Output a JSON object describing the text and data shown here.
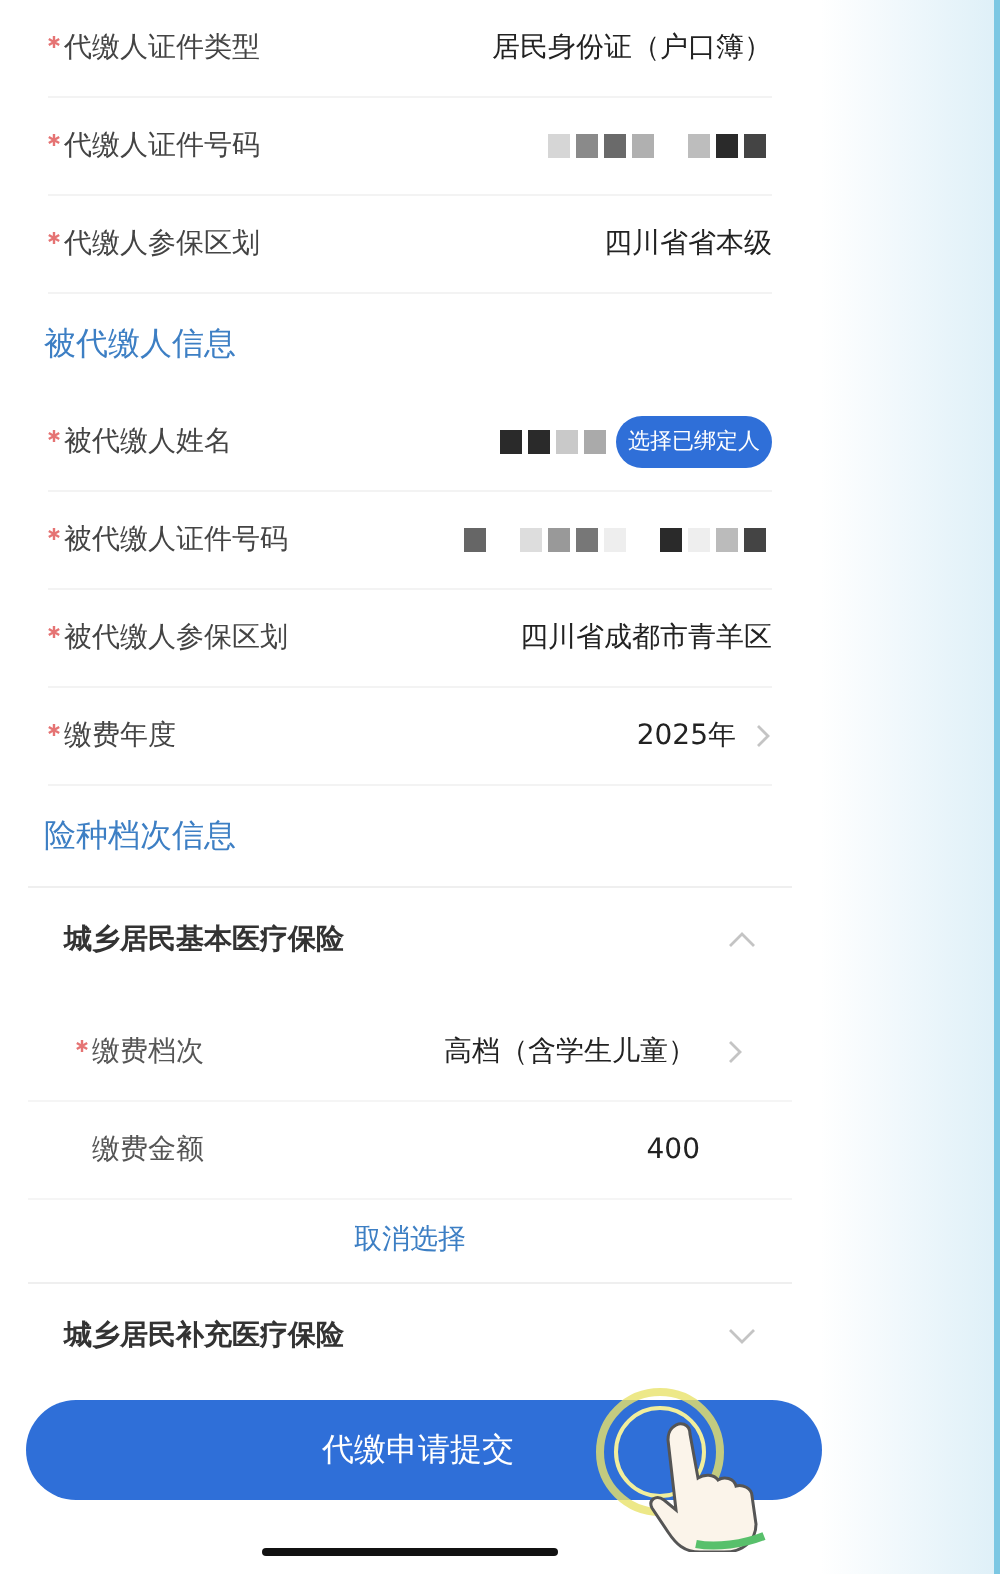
{
  "items": [
    {
      "kind": "field",
      "label": "代缴人证件类型",
      "required": true,
      "value": "居民身份证（户口簿）",
      "redacted": false,
      "chevron": false
    },
    {
      "kind": "field",
      "label": "代缴人证件号码",
      "required": true,
      "redacted": true,
      "chevron": false
    },
    {
      "kind": "field",
      "label": "代缴人参保区划",
      "required": true,
      "value": "四川省省本级",
      "redacted": false,
      "chevron": false
    },
    {
      "kind": "heading",
      "label": "被代缴人信息"
    },
    {
      "kind": "field",
      "label": "被代缴人姓名",
      "required": true,
      "redacted": true,
      "action": "选择已绑定人",
      "chevron": false
    },
    {
      "kind": "field",
      "label": "被代缴人证件号码",
      "required": true,
      "redacted": true,
      "chevron": false
    },
    {
      "kind": "field",
      "label": "被代缴人参保区划",
      "required": true,
      "value": "四川省成都市青羊区",
      "redacted": false,
      "chevron": false
    },
    {
      "kind": "field",
      "label": "缴费年度",
      "required": true,
      "value": "2025年",
      "redacted": false,
      "chevron": true
    },
    {
      "kind": "heading",
      "label": "险种档次信息"
    }
  ],
  "insurances": [
    {
      "title": "城乡居民基本医疗保险",
      "expanded": true,
      "fields": [
        {
          "label": "缴费档次",
          "required": true,
          "value": "高档（含学生儿童）",
          "chevron": true
        },
        {
          "label": "缴费金额",
          "required": false,
          "value": "400",
          "chevron": false
        }
      ],
      "cancel": "取消选择"
    },
    {
      "title": "城乡居民补充医疗保险",
      "expanded": false
    }
  ],
  "submit": "代缴申请提交"
}
